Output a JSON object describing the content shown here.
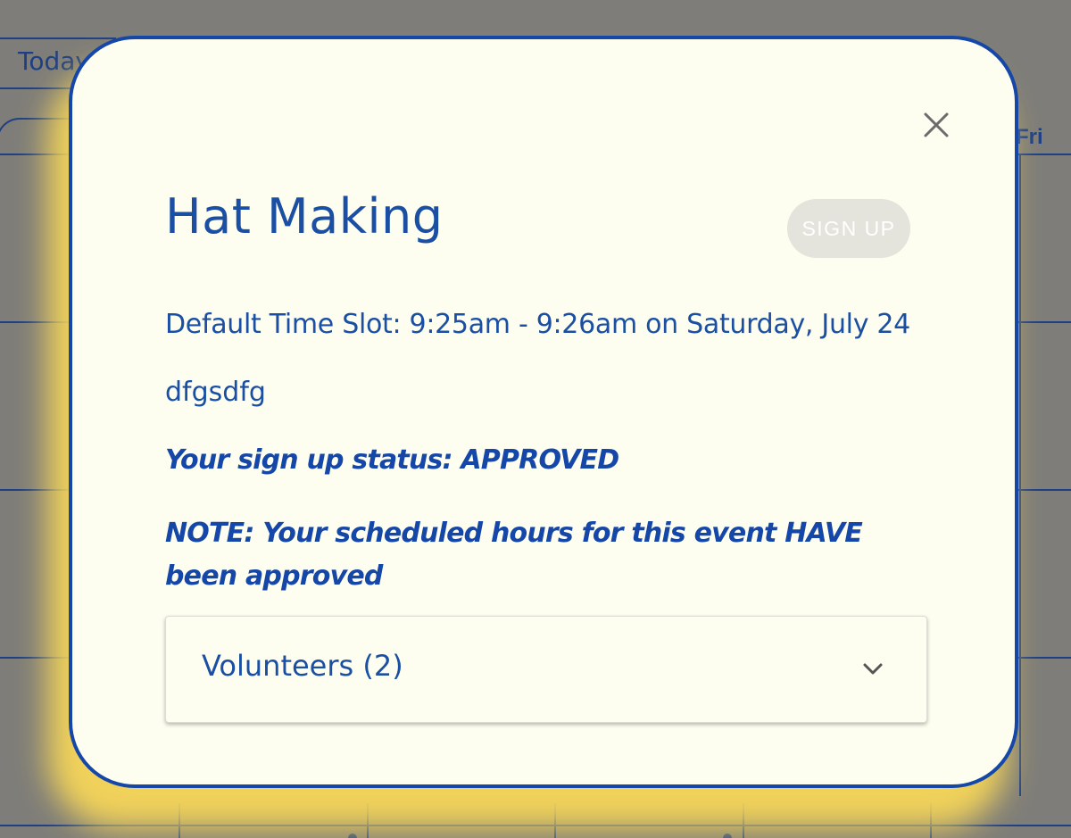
{
  "background": {
    "today_label": "Today",
    "day_label": "Fri"
  },
  "modal": {
    "title": "Hat Making",
    "signup_label": "SIGN UP",
    "time_slot": "Default Time Slot: 9:25am - 9:26am on Saturday, July 24",
    "description": "dfgsdfg",
    "status": "Your sign up status: APPROVED",
    "note": "NOTE: Your scheduled hours for this event HAVE been approved",
    "volunteers_label": "Volunteers (2)",
    "icons": {
      "close": "close-icon",
      "expand": "chevron-down-icon"
    }
  },
  "colors": {
    "primary": "#1a4fa4",
    "modal_border": "#1547a8",
    "modal_background": "#fdfdf0",
    "glow": "#f7d658",
    "overlay": "#7e7d79",
    "button_disabled_bg": "#e5e4dc"
  }
}
